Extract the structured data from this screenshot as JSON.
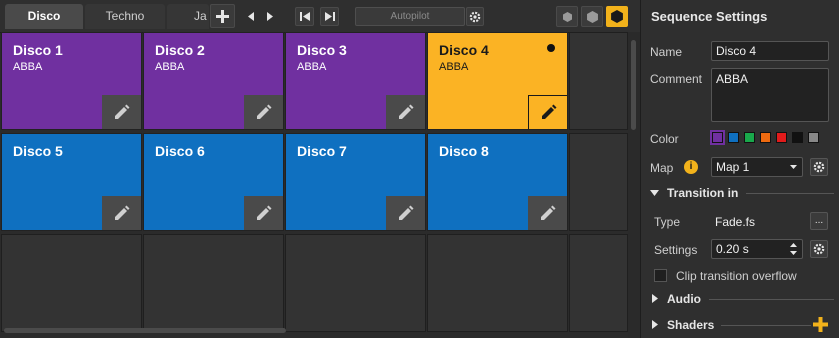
{
  "tabs": [
    {
      "label": "Disco",
      "active": true
    },
    {
      "label": "Techno",
      "active": false
    },
    {
      "label": "Ja",
      "active": false
    }
  ],
  "toolbar": {
    "autopilot_label": "Autopilot",
    "icons": [
      "plus-icon",
      "arrow-left-icon",
      "arrow-right-icon",
      "skip-back-icon",
      "skip-forward-icon",
      "gear-icon",
      "hexagon-small-icon",
      "hexagon-medium-icon",
      "hexagon-large-icon"
    ]
  },
  "sequences": [
    {
      "title": "Disco 1",
      "subtitle": "ABBA",
      "color": "#7030a0"
    },
    {
      "title": "Disco 2",
      "subtitle": "ABBA",
      "color": "#7030a0"
    },
    {
      "title": "Disco 3",
      "subtitle": "ABBA",
      "color": "#7030a0"
    },
    {
      "title": "Disco 4",
      "subtitle": "ABBA",
      "color": "#fbb324",
      "selected": true
    },
    {
      "title": "Disco 5",
      "subtitle": "",
      "color": "#0f70c0"
    },
    {
      "title": "Disco 6",
      "subtitle": "",
      "color": "#0f70c0"
    },
    {
      "title": "Disco 7",
      "subtitle": "",
      "color": "#0f70c0"
    },
    {
      "title": "Disco 8",
      "subtitle": "",
      "color": "#0f70c0"
    }
  ],
  "panel": {
    "title": "Sequence Settings",
    "name_label": "Name",
    "name_value": "Disco 4",
    "comment_label": "Comment",
    "comment_value": "ABBA",
    "color_label": "Color",
    "colors": [
      "#7030a0",
      "#0f70c0",
      "#19a84b",
      "#ee6a10",
      "#e21b1b",
      "#111111",
      "#888888"
    ],
    "map_label": "Map",
    "map_value": "Map 1",
    "transition_in_header": "Transition in",
    "type_label": "Type",
    "type_value": "Fade.fs",
    "type_button": "...",
    "settings_label": "Settings",
    "settings_value": "0.20 s",
    "clip_label": "Clip transition overflow",
    "audio_header": "Audio",
    "shaders_header": "Shaders"
  },
  "accent": "#f2b21b"
}
